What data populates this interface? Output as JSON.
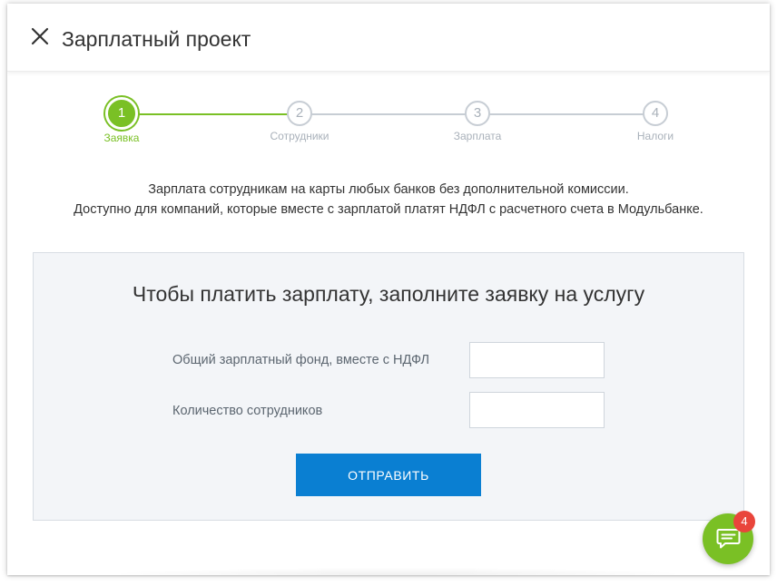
{
  "header": {
    "title": "Зарплатный проект",
    "close_icon": "close-icon"
  },
  "stepper": {
    "steps": [
      {
        "number": "1",
        "label": "Заявка",
        "active": true
      },
      {
        "number": "2",
        "label": "Сотрудники",
        "active": false
      },
      {
        "number": "3",
        "label": "Зарплата",
        "active": false
      },
      {
        "number": "4",
        "label": "Налоги",
        "active": false
      }
    ],
    "active_color": "#7ac025",
    "inactive_color": "#c7cdd4"
  },
  "intro": {
    "line1": "Зарплата сотрудникам на карты любых банков без дополнительной комиссии.",
    "line2": "Доступно для компаний, которые вместе с зарплатой платят НДФЛ с расчетного счета в Модульбанке."
  },
  "form": {
    "title": "Чтобы платить зарплату, заполните заявку на услугу",
    "fields": [
      {
        "label": "Общий зарплатный фонд, вместе с НДФЛ",
        "value": "",
        "placeholder": ""
      },
      {
        "label": "Количество сотрудников",
        "value": "",
        "placeholder": ""
      }
    ],
    "submit_label": "ОТПРАВИТЬ",
    "submit_color": "#0a7fd2"
  },
  "chat": {
    "icon": "chat-icon",
    "badge_count": "4",
    "badge_color": "#e9453b"
  }
}
